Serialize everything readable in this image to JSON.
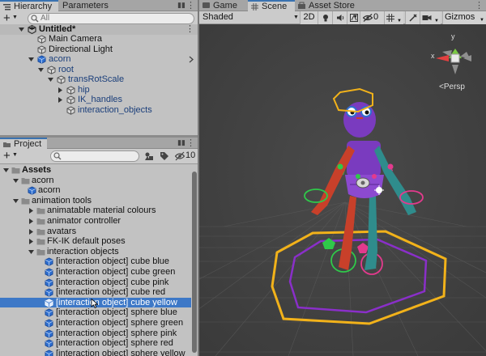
{
  "top_tabs": {
    "hierarchy": "Hierarchy",
    "parameters": "Parameters",
    "game": "Game",
    "scene": "Scene",
    "asset_store": "Asset Store"
  },
  "hierarchy": {
    "add_label": "+",
    "search_placeholder": "All",
    "items": [
      {
        "label": "Untitled*"
      },
      {
        "label": "Main Camera"
      },
      {
        "label": "Directional Light"
      },
      {
        "label": "acorn"
      },
      {
        "label": "root"
      },
      {
        "label": "transRotScale"
      },
      {
        "label": "hip"
      },
      {
        "label": "IK_handles"
      },
      {
        "label": "interaction_objects"
      }
    ]
  },
  "project": {
    "tab_label": "Project",
    "add_label": "+",
    "visibility_count": "10",
    "items": [
      {
        "label": "Assets"
      },
      {
        "label": "acorn"
      },
      {
        "label": "acorn"
      },
      {
        "label": "animation tools"
      },
      {
        "label": "animatable material colours"
      },
      {
        "label": "animator controller"
      },
      {
        "label": "avatars"
      },
      {
        "label": "FK-IK default poses"
      },
      {
        "label": "interaction objects"
      },
      {
        "label": "[interaction object] cube blue"
      },
      {
        "label": "[interaction object] cube green"
      },
      {
        "label": "[interaction object] cube pink"
      },
      {
        "label": "[interaction object] cube red"
      },
      {
        "label": "[interaction object] cube yellow"
      },
      {
        "label": "[interaction object] sphere blue"
      },
      {
        "label": "[interaction object] sphere green"
      },
      {
        "label": "[interaction object] sphere pink"
      },
      {
        "label": "[interaction object] sphere red"
      },
      {
        "label": "[interaction object] sphere yellow"
      }
    ]
  },
  "scene_toolbar": {
    "shading_mode": "Shaded",
    "mode_2d": "2D",
    "hidden_count": "0",
    "gizmos": "Gizmos"
  },
  "gizmo": {
    "x_label": "x",
    "y_label": "y",
    "projection": "Persp"
  },
  "colors": {
    "selection": "#3d78c7",
    "folder": "#8a8a8a",
    "prefab": "#2f6fcf",
    "scene_bg": "#444444",
    "character_purple": "#7a3bbf",
    "arm_red": "#c8402a",
    "arm_teal": "#2f8c8c",
    "ring_yellow": "#f2b21a",
    "ring_purple": "#8a2fc9"
  }
}
